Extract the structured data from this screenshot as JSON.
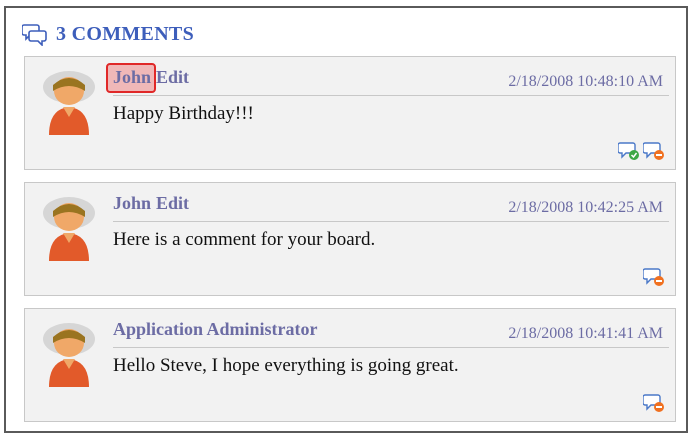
{
  "header": {
    "title": "3 COMMENTS",
    "icon": "comments-icon"
  },
  "comments": [
    {
      "author_name": "John",
      "edit_label": "Edit",
      "timestamp": "2/18/2008 10:48:10 AM",
      "text": "Happy Birthday!!!",
      "highlighted": true,
      "actions": [
        "approve-comment-icon",
        "delete-comment-icon"
      ]
    },
    {
      "author_name": "John",
      "edit_label": "Edit",
      "timestamp": "2/18/2008 10:42:25 AM",
      "text": "Here is a comment for your board.",
      "highlighted": false,
      "actions": [
        "delete-comment-icon"
      ]
    },
    {
      "author_name": "Application Administrator",
      "edit_label": "",
      "timestamp": "2/18/2008 10:41:41 AM",
      "text": "Hello Steve, I hope everything is going great.",
      "highlighted": false,
      "actions": [
        "delete-comment-icon"
      ]
    }
  ],
  "colors": {
    "header": "#3d5ebb",
    "author": "#6c6ca4",
    "panel": "#f2f2f2",
    "highlight_border": "#e02828"
  }
}
